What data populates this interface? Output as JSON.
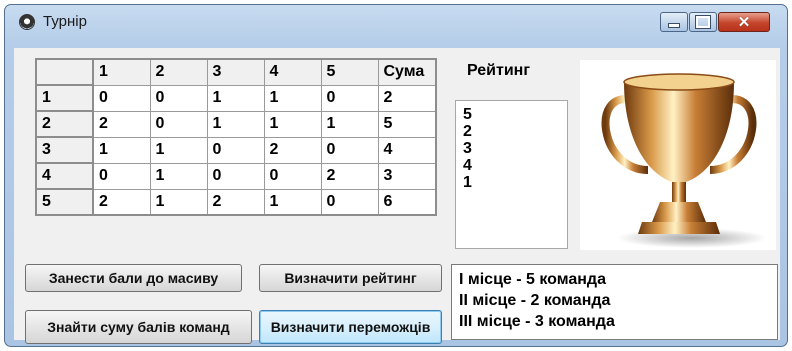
{
  "window": {
    "title": "Турнір"
  },
  "table": {
    "header": [
      "",
      "1",
      "2",
      "3",
      "4",
      "5",
      "Сума"
    ],
    "rows": [
      [
        "1",
        "0",
        "0",
        "1",
        "1",
        "0",
        "2"
      ],
      [
        "2",
        "2",
        "0",
        "1",
        "1",
        "1",
        "5"
      ],
      [
        "3",
        "1",
        "1",
        "0",
        "2",
        "0",
        "4"
      ],
      [
        "4",
        "0",
        "1",
        "0",
        "0",
        "2",
        "3"
      ],
      [
        "5",
        "2",
        "1",
        "2",
        "1",
        "0",
        "6"
      ]
    ]
  },
  "rating": {
    "label": "Рейтинг",
    "items": [
      "5",
      "2",
      "3",
      "4",
      "1"
    ]
  },
  "buttons": {
    "enter_scores": "Занести бали до масиву",
    "determine_rating": "Визначити рейтинг",
    "find_sum": "Знайти суму балів команд",
    "determine_winners": "Визначити переможців"
  },
  "results": [
    "I місце - 5 команда",
    "II місце - 2 команда",
    "III місце - 3 команда"
  ]
}
